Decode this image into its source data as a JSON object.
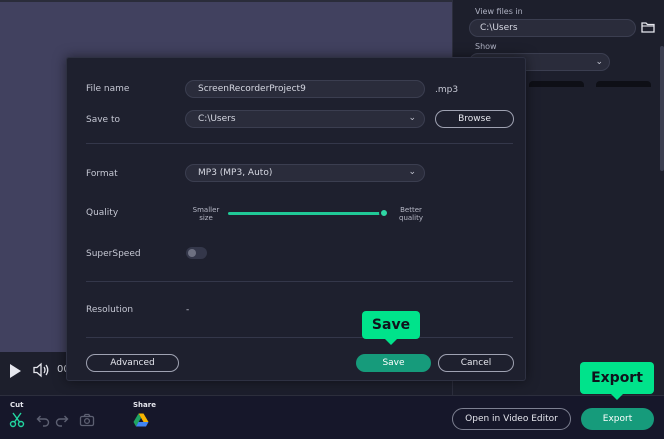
{
  "right_panel": {
    "view_files_label": "View files in",
    "path": "C:\\Users",
    "show_label": "Show"
  },
  "player": {
    "time": "00"
  },
  "bottom_bar": {
    "cut_label": "Cut",
    "share_label": "Share",
    "open_editor_label": "Open in Video Editor",
    "export_label": "Export"
  },
  "dialog": {
    "file_name_label": "File name",
    "file_name_value": "ScreenRecorderProject9",
    "extension": ".mp3",
    "save_to_label": "Save to",
    "save_to_value": "C:\\Users",
    "browse_label": "Browse",
    "format_label": "Format",
    "format_value": "MP3 (MP3, Auto)",
    "quality_label": "Quality",
    "quality_min_label": "Smaller size",
    "quality_max_label": "Better quality",
    "quality_level": 1.0,
    "superspeed_label": "SuperSpeed",
    "superspeed_on": false,
    "resolution_label": "Resolution",
    "resolution_value": "-",
    "advanced_label": "Advanced",
    "save_label": "Save",
    "cancel_label": "Cancel"
  },
  "tooltips": {
    "save": "Save",
    "export": "Export"
  },
  "colors": {
    "accent": "#169b7b",
    "tooltip": "#00e38b",
    "slider": "#20c997"
  },
  "icons": [
    "folder-icon",
    "chevron-down-icon",
    "play-icon",
    "volume-icon",
    "scissors-icon",
    "undo-icon",
    "redo-icon",
    "camera-icon",
    "google-drive-icon"
  ]
}
